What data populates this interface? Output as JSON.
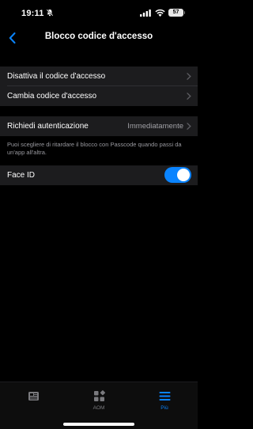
{
  "status_bar": {
    "time": "19:11",
    "battery": "57",
    "icons": [
      "bell-muted-icon",
      "signal-icon",
      "wifi-icon",
      "battery-icon"
    ]
  },
  "nav": {
    "title": "Blocco codice d'accesso",
    "back_icon": "chevron-left-icon"
  },
  "passcode_group": {
    "items": [
      {
        "label": "Disattiva il codice d'accesso"
      },
      {
        "label": "Cambia codice d'accesso"
      }
    ]
  },
  "auth_group": {
    "label": "Richiedi autenticazione",
    "value": "Immediatamente"
  },
  "footnote": "Puoi scegliere di ritardare il blocco con Passcode quando passi da un'app all'altra.",
  "face_id": {
    "label": "Face ID",
    "enabled": true
  },
  "tab_bar": {
    "tabs": [
      {
        "label": "",
        "icon": "newspaper-icon"
      },
      {
        "label": "AOM",
        "icon": "grid-diamond-icon"
      },
      {
        "label": "Più",
        "icon": "hamburger-menu-icon"
      }
    ],
    "active_index": 2
  },
  "colors": {
    "background": "#000000",
    "cell": "#1c1c1e",
    "accent": "#0a84ff",
    "secondary_text": "#a0a0a5"
  }
}
